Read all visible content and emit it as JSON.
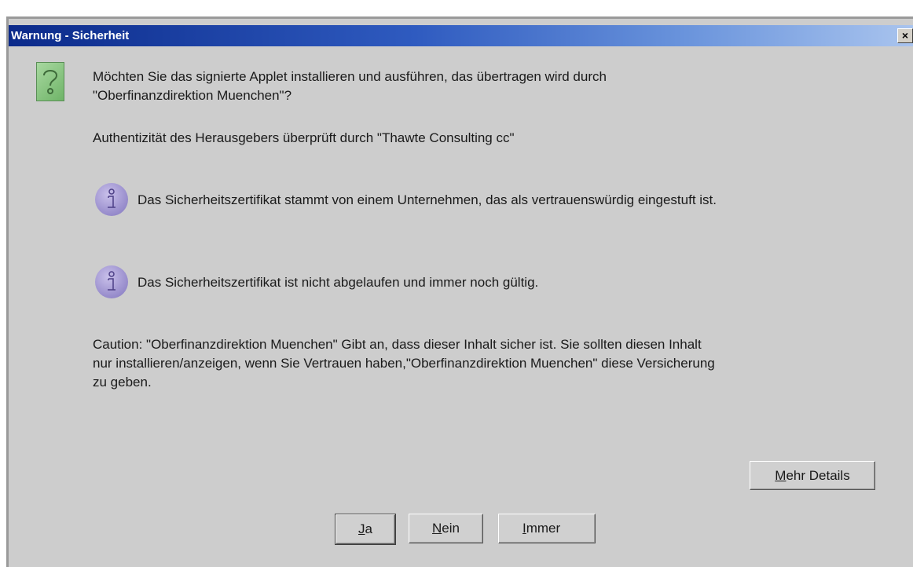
{
  "window": {
    "title": "Warnung - Sicherheit",
    "close_glyph": "×"
  },
  "question": {
    "line1": "Möchten Sie das signierte Applet installieren und ausführen, das übertragen wird durch",
    "line2": "\"Oberfinanzdirektion Muenchen\"?"
  },
  "authenticity": "Authentizität des Herausgebers überprüft durch \"Thawte Consulting cc\"",
  "info_items": [
    {
      "text": "Das Sicherheitszertifikat stammt von einem Unternehmen, das als vertrauenswürdig eingestuft ist."
    },
    {
      "text": "Das Sicherheitszertifikat ist nicht abgelaufen und immer noch gültig."
    }
  ],
  "caution": {
    "line1": "Caution: \"Oberfinanzdirektion Muenchen\" Gibt an, dass dieser Inhalt sicher ist. Sie sollten diesen Inhalt",
    "line2": "nur installieren/anzeigen, wenn Sie Vertrauen haben,\"Oberfinanzdirektion Muenchen\" diese Versicherung",
    "line3": "zu geben."
  },
  "buttons": {
    "details": {
      "mnemonic": "M",
      "rest": "ehr Details"
    },
    "yes": {
      "mnemonic": "J",
      "rest": "a"
    },
    "no": {
      "mnemonic": "N",
      "rest": "ein"
    },
    "always": {
      "mnemonic": "I",
      "rest": "mmer"
    }
  },
  "colors": {
    "titlebar_start": "#0b2a8a",
    "titlebar_end": "#a9c4ee",
    "dialog_bg": "#cdcdcd"
  }
}
